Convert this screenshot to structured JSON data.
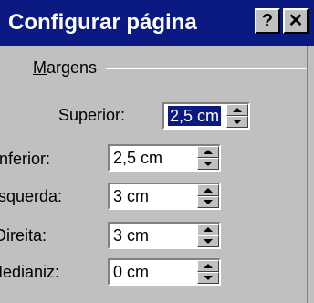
{
  "dialog": {
    "title": "Configurar página",
    "help_glyph": "?",
    "close_glyph": "✕"
  },
  "margins": {
    "group_label": "Margens",
    "fields": [
      {
        "label": "Superior:",
        "value": "2,5 cm"
      },
      {
        "label": "Inferior:",
        "value": "2,5 cm"
      },
      {
        "label": "Esquerda:",
        "value": "3 cm"
      },
      {
        "label": "Direita:",
        "value": "3 cm"
      },
      {
        "label": "Medianiz:",
        "value": "0 cm"
      }
    ]
  },
  "colors": {
    "titlebar": "#0a1a82",
    "face": "#c0c0c0",
    "field_bg": "#ffffff"
  },
  "icons": [
    "help-icon",
    "close-icon",
    "spin-up-icon",
    "spin-down-icon"
  ]
}
